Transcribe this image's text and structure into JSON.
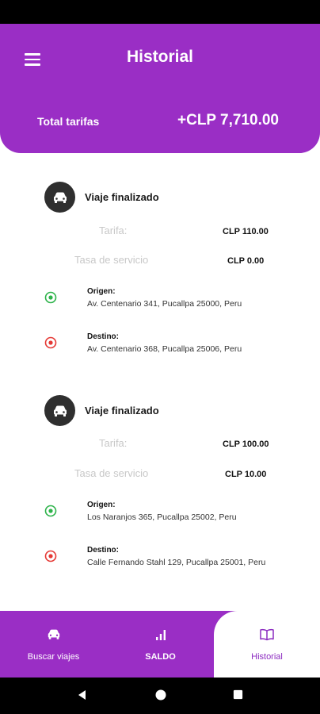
{
  "header": {
    "title": "Historial",
    "total_label": "Total tarifas",
    "total_value": "+CLP 7,710.00"
  },
  "trips": [
    {
      "status": "Viaje finalizado",
      "fare_label": "Tarifa:",
      "fare_value": "CLP 110.00",
      "service_label": "Tasa de servicio",
      "service_value": "CLP 0.00",
      "origin_label": "Origen:",
      "origin_address": "Av. Centenario 341, Pucallpa 25000, Peru",
      "destination_label": "Destino:",
      "destination_address": "Av. Centenario 368, Pucallpa 25006, Peru"
    },
    {
      "status": "Viaje finalizado",
      "fare_label": "Tarifa:",
      "fare_value": "CLP 100.00",
      "service_label": "Tasa de servicio",
      "service_value": "CLP 10.00",
      "origin_label": "Origen:",
      "origin_address": "Los Naranjos 365, Pucallpa 25002, Peru",
      "destination_label": "Destino:",
      "destination_address": "Calle Fernando Stahl 129, Pucallpa 25001, Peru"
    }
  ],
  "bottom_nav": {
    "buscar": "Buscar viajes",
    "saldo": "SALDO",
    "historial": "Historial"
  },
  "icons": {
    "menu": "hamburger-menu-icon",
    "car": "car-icon",
    "origin": "origin-marker-icon",
    "destination": "destination-marker-icon",
    "saldo": "bar-chart-icon",
    "historial": "book-icon"
  },
  "colors": {
    "primary": "#9a2ec5",
    "origin_marker": "#2db34a",
    "destination_marker": "#e53935",
    "car_badge": "#2f2f2f"
  }
}
